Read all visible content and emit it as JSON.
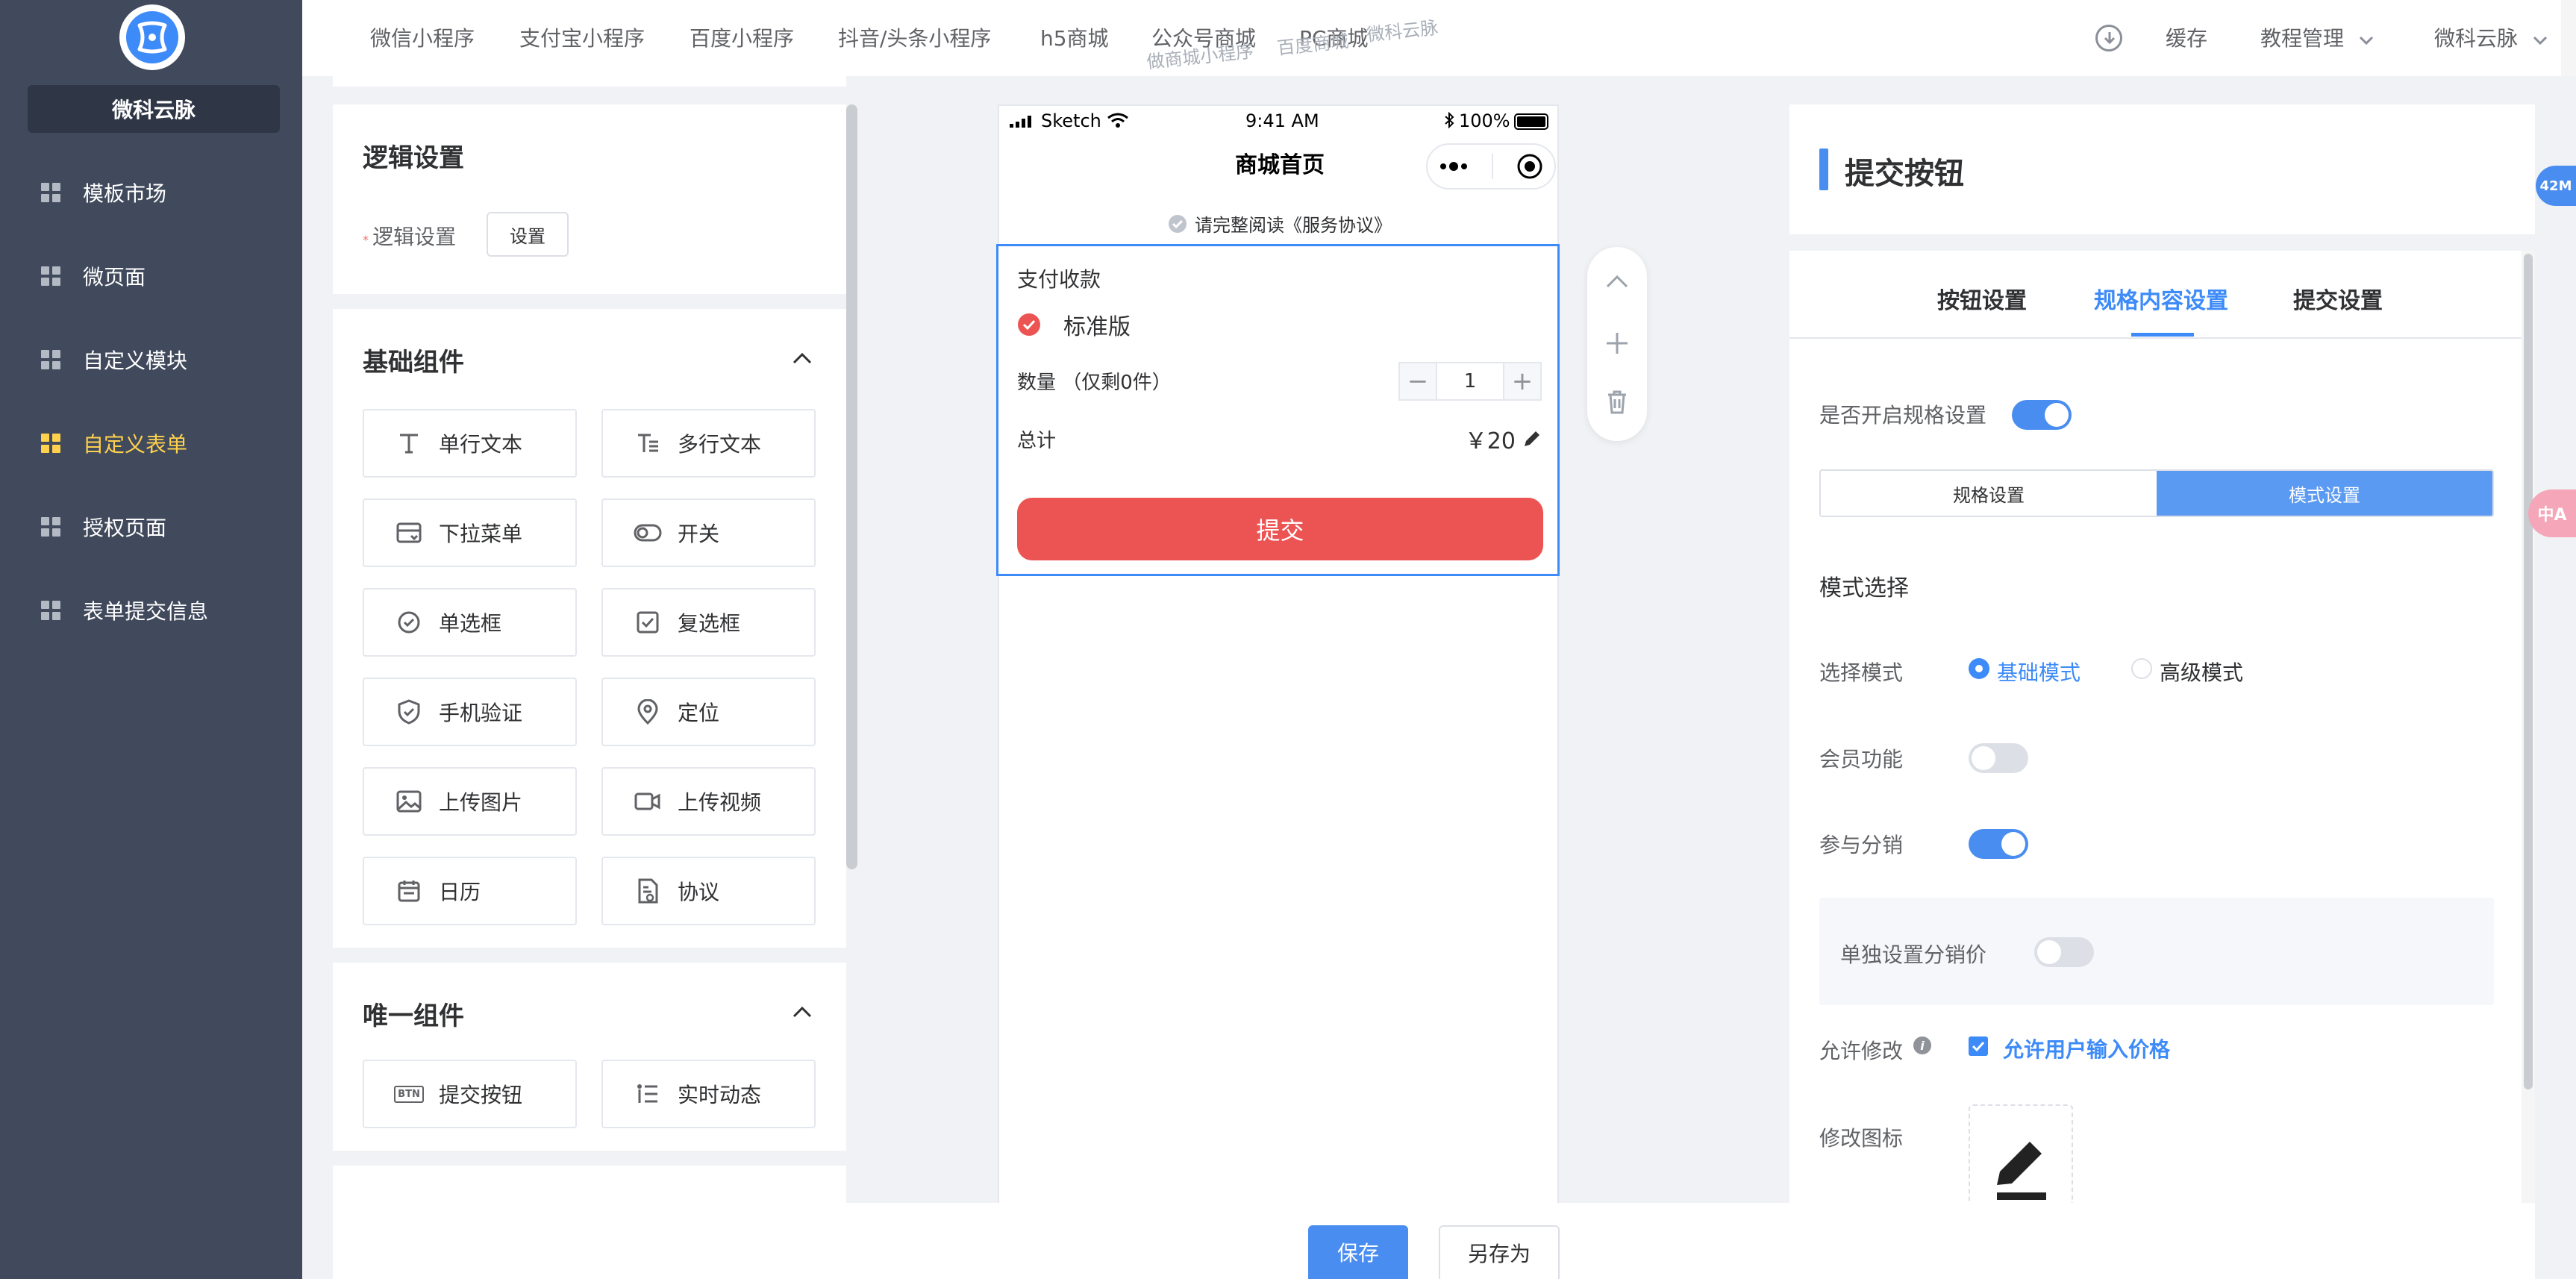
{
  "sidebar": {
    "brand": "微科云脉",
    "items": [
      {
        "label": "模板市场"
      },
      {
        "label": "微页面"
      },
      {
        "label": "自定义模块"
      },
      {
        "label": "自定义表单"
      },
      {
        "label": "授权页面"
      },
      {
        "label": "表单提交信息"
      }
    ],
    "active_index": 3
  },
  "topbar": {
    "links": [
      "微信小程序",
      "支付宝小程序",
      "百度小程序",
      "抖音/头条小程序",
      "h5商城",
      "公众号商城",
      "PC商城"
    ],
    "watermark_1": "做商城小程序",
    "watermark_2": "百度商城",
    "watermark_3": "微科云脉",
    "cache": "缓存",
    "tutorial": "教程管理",
    "user": "微科云脉"
  },
  "logic": {
    "title": "逻辑设置",
    "req": "*",
    "label": "逻辑设置",
    "button": "设置"
  },
  "basic": {
    "title": "基础组件",
    "items": [
      {
        "label": "单行文本",
        "icon": "text-icon"
      },
      {
        "label": "多行文本",
        "icon": "multiline-text-icon"
      },
      {
        "label": "下拉菜单",
        "icon": "dropdown-icon"
      },
      {
        "label": "开关",
        "icon": "switch-icon"
      },
      {
        "label": "单选框",
        "icon": "radio-icon"
      },
      {
        "label": "复选框",
        "icon": "checkbox-icon"
      },
      {
        "label": "手机验证",
        "icon": "shield-icon"
      },
      {
        "label": "定位",
        "icon": "location-icon"
      },
      {
        "label": "上传图片",
        "icon": "image-icon"
      },
      {
        "label": "上传视频",
        "icon": "video-icon"
      },
      {
        "label": "日历",
        "icon": "calendar-icon"
      },
      {
        "label": "协议",
        "icon": "agreement-icon"
      }
    ]
  },
  "unique": {
    "title": "唯一组件",
    "items": [
      {
        "label": "提交按钮",
        "icon": "button-icon",
        "badge": "BTN"
      },
      {
        "label": "实时动态",
        "icon": "list-icon"
      }
    ]
  },
  "phone": {
    "signal": "Sketch",
    "time": "9:41 AM",
    "battery": "100%",
    "title": "商城首页",
    "agreement": "请完整阅读《服务协议》",
    "form": {
      "title": "支付收款",
      "option": "标准版",
      "qty_label": "数量 （仅剩0件）",
      "qty_value": "1",
      "minus": "−",
      "plus": "+",
      "total_label": "总计",
      "total_value": "￥20",
      "submit": "提交"
    }
  },
  "settings": {
    "header": "提交按钮",
    "tabs": [
      "按钮设置",
      "规格内容设置",
      "提交设置"
    ],
    "active_tab": 1,
    "enable_spec_label": "是否开启规格设置",
    "enable_spec": true,
    "seg": [
      "规格设置",
      "模式设置"
    ],
    "seg_active": 1,
    "mode_title": "模式选择",
    "select_mode_label": "选择模式",
    "mode_options": [
      "基础模式",
      "高级模式"
    ],
    "mode_selected": 0,
    "member_label": "会员功能",
    "member": false,
    "distribution_label": "参与分销",
    "distribution": true,
    "separate_price_label": "单独设置分销价",
    "separate_price": false,
    "allow_edit_label": "允许修改",
    "allow_edit_checkbox": "允许用户输入价格",
    "allow_edit": true,
    "edit_icon_label": "修改图标"
  },
  "side_badges": {
    "memory": "42M",
    "float": "中A"
  },
  "footer": {
    "save": "保存",
    "save_as": "另存为"
  },
  "colors": {
    "sidebar": "#404a5c",
    "accent": "#3d8bf8",
    "active_nav": "#ffd14d",
    "submit_red": "#ec5453"
  }
}
